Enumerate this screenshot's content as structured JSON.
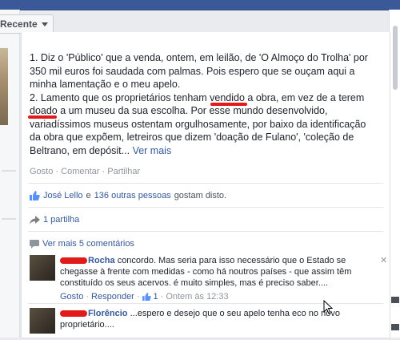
{
  "feed": {
    "sort_label": "Recente"
  },
  "post": {
    "paragraph1": "1. Diz o 'Público' que a venda, ontem, em leilão, de 'O Almoço do Trolha' por 350 mil euros foi saudada com palmas. Pois espero que se ouçam aqui a minha lamentação e o meu apelo.",
    "paragraph2": "2. Lamento que os proprietários tenham vendido a obra, em vez de a terem doado a um museu da sua escolha. Por esse mundo desenvolvido, variadíssimos museus ostentam orgulhosamente, por baixo da identificação da obra que expõem, letreiros que dizem 'doação de Fulano', 'coleção de Beltrano, em depósit...",
    "see_more": "Ver mais"
  },
  "actions": {
    "like": "Gosto",
    "comment": "Comentar",
    "share": "Partilhar",
    "separator": "·"
  },
  "likes": {
    "person": "José Lello",
    "conjunction": "e",
    "others": "136 outras pessoas",
    "suffix": "gostam disto."
  },
  "shares": {
    "label": "1 partilha"
  },
  "comments": {
    "view_more": "Ver mais 5 comentários",
    "items": [
      {
        "author": "Rocha",
        "text": "concordo. Mas seria para isso necessário que o Estado se chegasse à frente com medidas - como há noutros países - que assim têm constituído os seus acervos. é muito simples, mas é preciso saber....",
        "like": "Gosto",
        "reply": "Responder",
        "like_count": "1",
        "time": "Ontem às 12:33",
        "close": "✕"
      },
      {
        "author": "Florêncio",
        "text": "...espero e desejo que o seu apelo tenha eco no novo proprietário...."
      }
    ]
  }
}
